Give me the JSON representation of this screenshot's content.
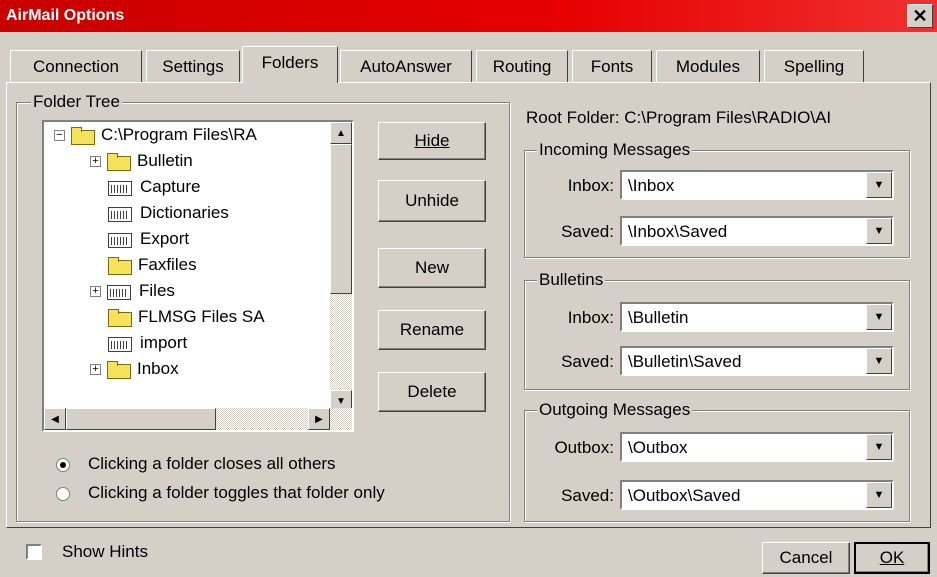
{
  "window": {
    "title": "AirMail Options",
    "close_glyph": "✕"
  },
  "tabs": [
    {
      "label": "Connection"
    },
    {
      "label": "Settings"
    },
    {
      "label": "Folders"
    },
    {
      "label": "AutoAnswer"
    },
    {
      "label": "Routing"
    },
    {
      "label": "Fonts"
    },
    {
      "label": "Modules"
    },
    {
      "label": "Spelling"
    }
  ],
  "active_tab": "Folders",
  "folder_tree": {
    "label": "Folder Tree",
    "items": [
      {
        "label": "C:\\Program Files\\RA",
        "expander": "−",
        "icon": "folder-icon"
      },
      {
        "label": "Bulletin",
        "expander": "+",
        "icon": "folder-icon"
      },
      {
        "label": "Capture",
        "expander": "",
        "icon": "open-folder-icon"
      },
      {
        "label": "Dictionaries",
        "expander": "",
        "icon": "open-folder-icon"
      },
      {
        "label": "Export",
        "expander": "",
        "icon": "open-folder-icon"
      },
      {
        "label": "Faxfiles",
        "expander": "",
        "icon": "folder-icon"
      },
      {
        "label": "Files",
        "expander": "+",
        "icon": "open-folder-icon"
      },
      {
        "label": "FLMSG Files  SA",
        "expander": "",
        "icon": "folder-icon"
      },
      {
        "label": "import",
        "expander": "",
        "icon": "open-folder-icon"
      },
      {
        "label": "Inbox",
        "expander": "+",
        "icon": "folder-icon"
      }
    ]
  },
  "buttons": {
    "hide": "Hide",
    "unhide": "Unhide",
    "new": "New",
    "rename": "Rename",
    "delete": "Delete"
  },
  "radio_options": [
    {
      "label": "Clicking a folder closes all others",
      "checked": true
    },
    {
      "label": "Clicking a folder toggles that folder only",
      "checked": false
    }
  ],
  "root_folder": "Root Folder: C:\\Program Files\\RADIO\\AI",
  "incoming": {
    "title": "Incoming Messages",
    "inbox_label": "Inbox:",
    "inbox_value": "\\Inbox",
    "saved_label": "Saved:",
    "saved_value": "\\Inbox\\Saved"
  },
  "bulletins": {
    "title": "Bulletins",
    "inbox_label": "Inbox:",
    "inbox_value": "\\Bulletin",
    "saved_label": "Saved:",
    "saved_value": "\\Bulletin\\Saved"
  },
  "outgoing": {
    "title": "Outgoing Messages",
    "outbox_label": "Outbox:",
    "outbox_value": "\\Outbox",
    "saved_label": "Saved:",
    "saved_value": "\\Outbox\\Saved"
  },
  "footer": {
    "show_hints": "Show Hints",
    "cancel": "Cancel",
    "ok": "OK"
  },
  "colors": {
    "titlebar": "#e00000",
    "face": "#d4d0c8"
  }
}
